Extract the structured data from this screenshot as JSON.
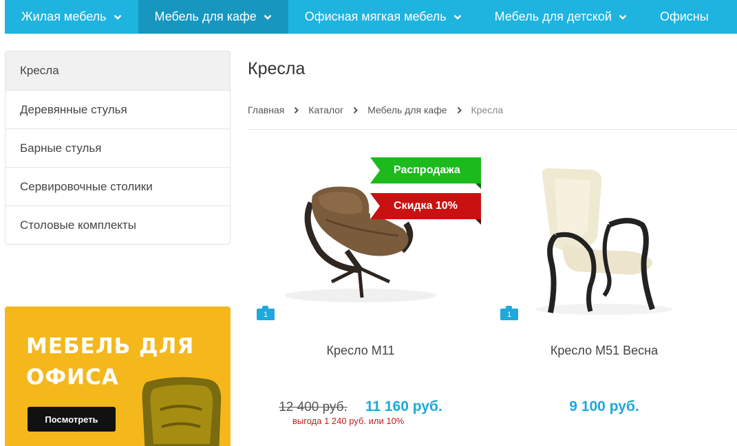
{
  "topnav": {
    "items": [
      {
        "label": "Жилая мебель"
      },
      {
        "label": "Мебель для кафе"
      },
      {
        "label": "Офисная мягкая мебель"
      },
      {
        "label": "Мебель для детской"
      },
      {
        "label": "Офисны"
      }
    ]
  },
  "sidebar": {
    "items": [
      {
        "label": "Кресла"
      },
      {
        "label": "Деревянные стулья"
      },
      {
        "label": "Барные стулья"
      },
      {
        "label": "Сервировочные столики"
      },
      {
        "label": "Столовые комплекты"
      }
    ]
  },
  "banner": {
    "title": "МЕБЕЛЬ ДЛЯ ОФИСА",
    "button_label": "Посмотреть"
  },
  "page": {
    "title": "Кресла"
  },
  "breadcrumb": {
    "items": [
      "Главная",
      "Каталог",
      "Мебель для кафе",
      "Кресла"
    ]
  },
  "products": [
    {
      "name": "Кресло М11",
      "old_price": "12 400 руб.",
      "price": "11 160 руб.",
      "savings": "выгода 1 240 руб. или 10%",
      "photo_count": "1",
      "ribbons": [
        "Распродажа",
        "Скидка 10%"
      ]
    },
    {
      "name": "Кресло М51 Весна",
      "price": "9 100 руб.",
      "photo_count": "1"
    }
  ],
  "colors": {
    "nav": "#1fb3e0",
    "nav_active": "#1797c0",
    "price": "#1fa8dc",
    "sale": "#1dba1d",
    "discount": "#c91111",
    "banner": "#f4b81c"
  }
}
